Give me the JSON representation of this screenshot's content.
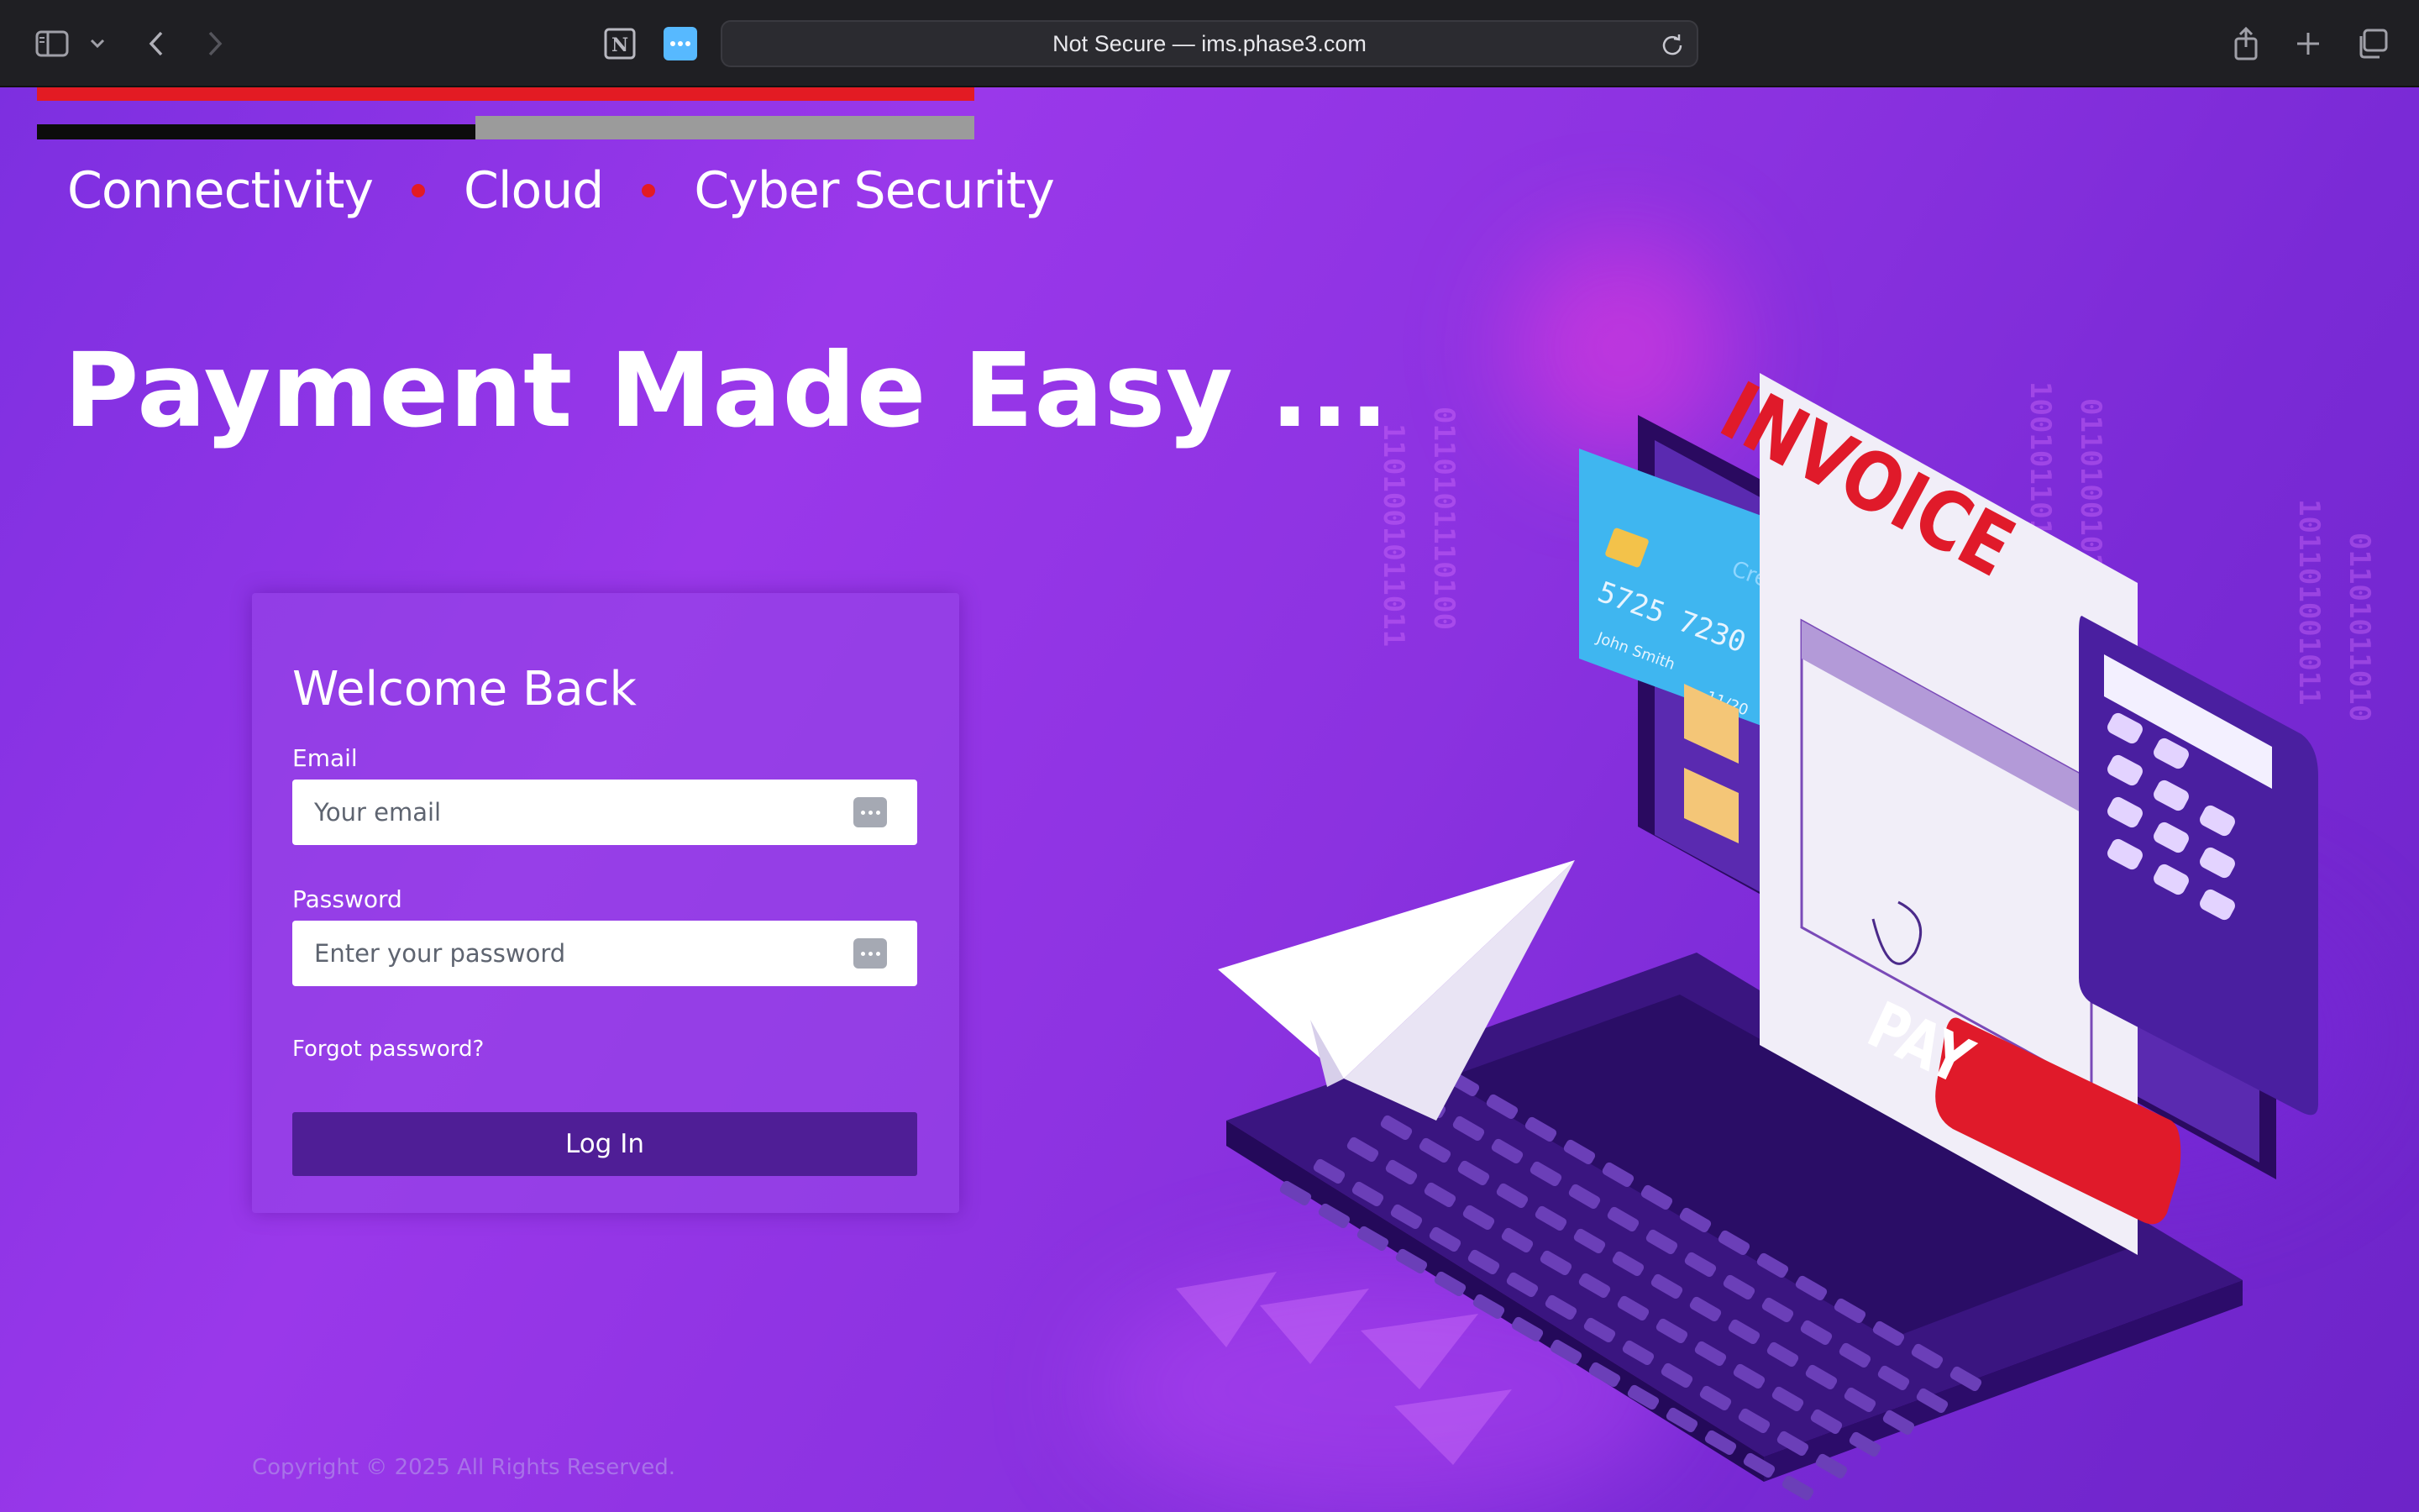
{
  "browser": {
    "address": "Not Secure — ims.phase3.com",
    "extension_notion_label": "N"
  },
  "brand": {
    "tagline": [
      "Connectivity",
      "Cloud",
      "Cyber Security"
    ],
    "bar_colors": {
      "red": "#e31b23",
      "black": "#0c0c0c",
      "gray": "#9b9b9b"
    }
  },
  "hero": {
    "title": "Payment Made Easy ..."
  },
  "login": {
    "title": "Welcome Back",
    "email_label": "Email",
    "email_placeholder": "Your email",
    "password_label": "Password",
    "password_placeholder": "Enter your password",
    "forgot_label": "Forgot password?",
    "login_button": "Log In"
  },
  "footer": {
    "copyright": "Copyright © 2025 All Rights Reserved."
  },
  "illustration": {
    "invoice_label": "INVOICE",
    "pay_label": "PAY",
    "card_number": "5725 7230 77",
    "card_holder": "John Smith",
    "card_expiry": "11/20",
    "card_brand": "Cre"
  },
  "colors": {
    "accent_purple": "#9a38ea",
    "button_purple": "#4f1e96",
    "brand_red": "#e31b23"
  }
}
